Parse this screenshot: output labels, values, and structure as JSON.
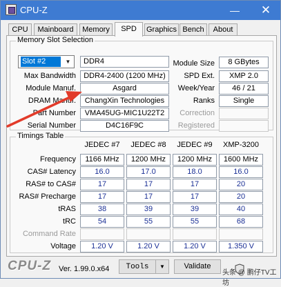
{
  "window": {
    "title": "CPU-Z",
    "minimize_glyph": "—",
    "close_glyph": "✕"
  },
  "tabs": [
    {
      "label": "CPU",
      "active": false
    },
    {
      "label": "Mainboard",
      "active": false
    },
    {
      "label": "Memory",
      "active": false
    },
    {
      "label": "SPD",
      "active": true
    },
    {
      "label": "Graphics",
      "active": false
    },
    {
      "label": "Bench",
      "active": false
    },
    {
      "label": "About",
      "active": false
    }
  ],
  "slot_section": {
    "title": "Memory Slot Selection",
    "slot_value": "Slot #2",
    "memory_type": "DDR4",
    "max_bandwidth": {
      "label": "Max Bandwidth",
      "value": "DDR4-2400 (1200 MHz)"
    },
    "module_manuf": {
      "label": "Module Manuf.",
      "value": "Asgard"
    },
    "dram_manuf": {
      "label": "DRAM Manuf.",
      "value": "ChangXin Technologies"
    },
    "part_number": {
      "label": "Part Number",
      "value": "VMA45UG-MIC1U22T2"
    },
    "serial_number": {
      "label": "Serial Number",
      "value": "D4C16F9C"
    },
    "module_size": {
      "label": "Module Size",
      "value": "8 GBytes"
    },
    "spd_ext": {
      "label": "SPD Ext.",
      "value": "XMP 2.0"
    },
    "week_year": {
      "label": "Week/Year",
      "value": "46 / 21"
    },
    "ranks": {
      "label": "Ranks",
      "value": "Single"
    },
    "correction": {
      "label": "Correction",
      "value": ""
    },
    "registered": {
      "label": "Registered",
      "value": ""
    }
  },
  "timings": {
    "title": "Timings Table",
    "columns": [
      "JEDEC #7",
      "JEDEC #8",
      "JEDEC #9",
      "XMP-3200"
    ],
    "rows": [
      {
        "label": "Frequency",
        "values": [
          "1166 MHz",
          "1200 MHz",
          "1200 MHz",
          "1600 MHz"
        ],
        "dim": false,
        "blue": false
      },
      {
        "label": "CAS# Latency",
        "values": [
          "16.0",
          "17.0",
          "18.0",
          "16.0"
        ],
        "dim": false,
        "blue": true
      },
      {
        "label": "RAS# to CAS#",
        "values": [
          "17",
          "17",
          "17",
          "20"
        ],
        "dim": false,
        "blue": true
      },
      {
        "label": "RAS# Precharge",
        "values": [
          "17",
          "17",
          "17",
          "20"
        ],
        "dim": false,
        "blue": true
      },
      {
        "label": "tRAS",
        "values": [
          "38",
          "39",
          "39",
          "40"
        ],
        "dim": false,
        "blue": true
      },
      {
        "label": "tRC",
        "values": [
          "54",
          "55",
          "55",
          "68"
        ],
        "dim": false,
        "blue": true
      },
      {
        "label": "Command Rate",
        "values": [
          "",
          "",
          "",
          ""
        ],
        "dim": true,
        "blue": false
      },
      {
        "label": "Voltage",
        "values": [
          "1.20 V",
          "1.20 V",
          "1.20 V",
          "1.350 V"
        ],
        "dim": false,
        "blue": true
      }
    ]
  },
  "footer": {
    "logo": "CPU-Z",
    "version": "Ver. 1.99.0.x64",
    "tools_label": "Tools",
    "validate_label": "Validate",
    "watermark": "头条 @ 鹏仔TV工坊"
  },
  "colors": {
    "titlebar": "#3e7bd2",
    "annotation_arrow": "#e23b2a",
    "value_blue": "#1a2f95"
  }
}
